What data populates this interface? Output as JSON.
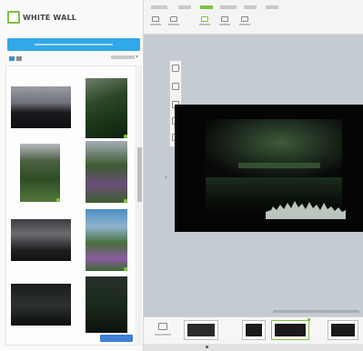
{
  "app": {
    "logo_text": "WHITE WALL",
    "accent_green": "#7cc243",
    "accent_blue": "#31a9e8"
  },
  "sidebar": {
    "upload_icon": "upload-icon",
    "view_toggle_icons": [
      "grid-view-icon",
      "list-view-icon"
    ],
    "photos": [
      {
        "name": "photo-misty-forest"
      },
      {
        "name": "photo-waterfall"
      },
      {
        "name": "photo-green-ferns"
      },
      {
        "name": "photo-flowers-forest"
      },
      {
        "name": "photo-fog-valley"
      },
      {
        "name": "photo-lupine-meadow"
      },
      {
        "name": "photo-dark-lake"
      },
      {
        "name": "photo-dark-forest"
      }
    ]
  },
  "toolbar": {
    "menu_icons": [
      "undo-icon",
      "redo-icon",
      "crop-icon",
      "filter-icon",
      "text-icon",
      "frame-icon"
    ]
  },
  "canvas": {
    "side_tools": [
      "layout-icon",
      "crop-icon",
      "adjust-icon",
      "frame-icon",
      "mount-icon"
    ],
    "nav_arrow": "‹",
    "photo": "dark-lake-reflection"
  },
  "bottom_bar": {
    "icons": [
      "add-icon",
      "format-icon",
      "preview-icon",
      "cart-icon"
    ]
  }
}
